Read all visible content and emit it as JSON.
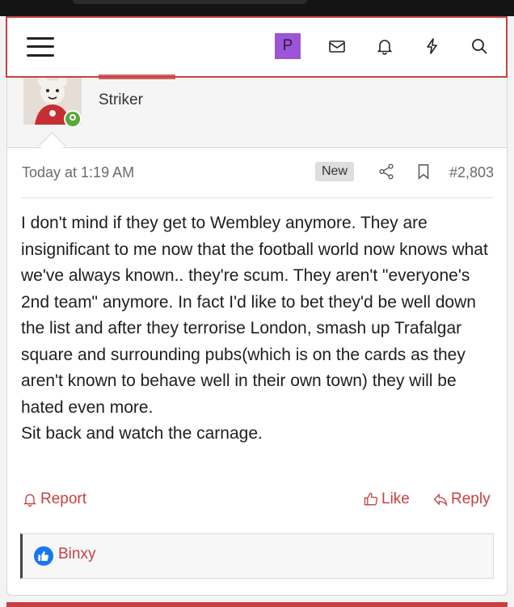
{
  "nav": {
    "avatar_letter": "P",
    "icons": [
      "menu-icon",
      "mail-icon",
      "bell-icon",
      "lightning-icon",
      "search-icon"
    ],
    "avatar_color": "#9c55d6"
  },
  "user": {
    "title": "Striker",
    "status": "online"
  },
  "post": {
    "time": "Today at 1:19 AM",
    "badge": "New",
    "number": "#2,803",
    "lines": [
      "I don't mind if they get to Wembley anymore. They are insignificant to me now that the football world now knows what we've always known.. they're scum. They aren't \"everyone's 2nd team\" anymore. In fact I'd like to bet they'd be well down the list and after they terrorise London, smash up Trafalgar square and surrounding pubs(which is on the cards as they aren't known to behave well in their own town) they will be hated even more.",
      "Sit back and watch the carnage."
    ]
  },
  "actions": {
    "report": "Report",
    "like": "Like",
    "reply": "Reply"
  },
  "reactions": {
    "users": "Binxy"
  },
  "colors": {
    "accent": "#c74141",
    "like_blue": "#1877f2"
  }
}
